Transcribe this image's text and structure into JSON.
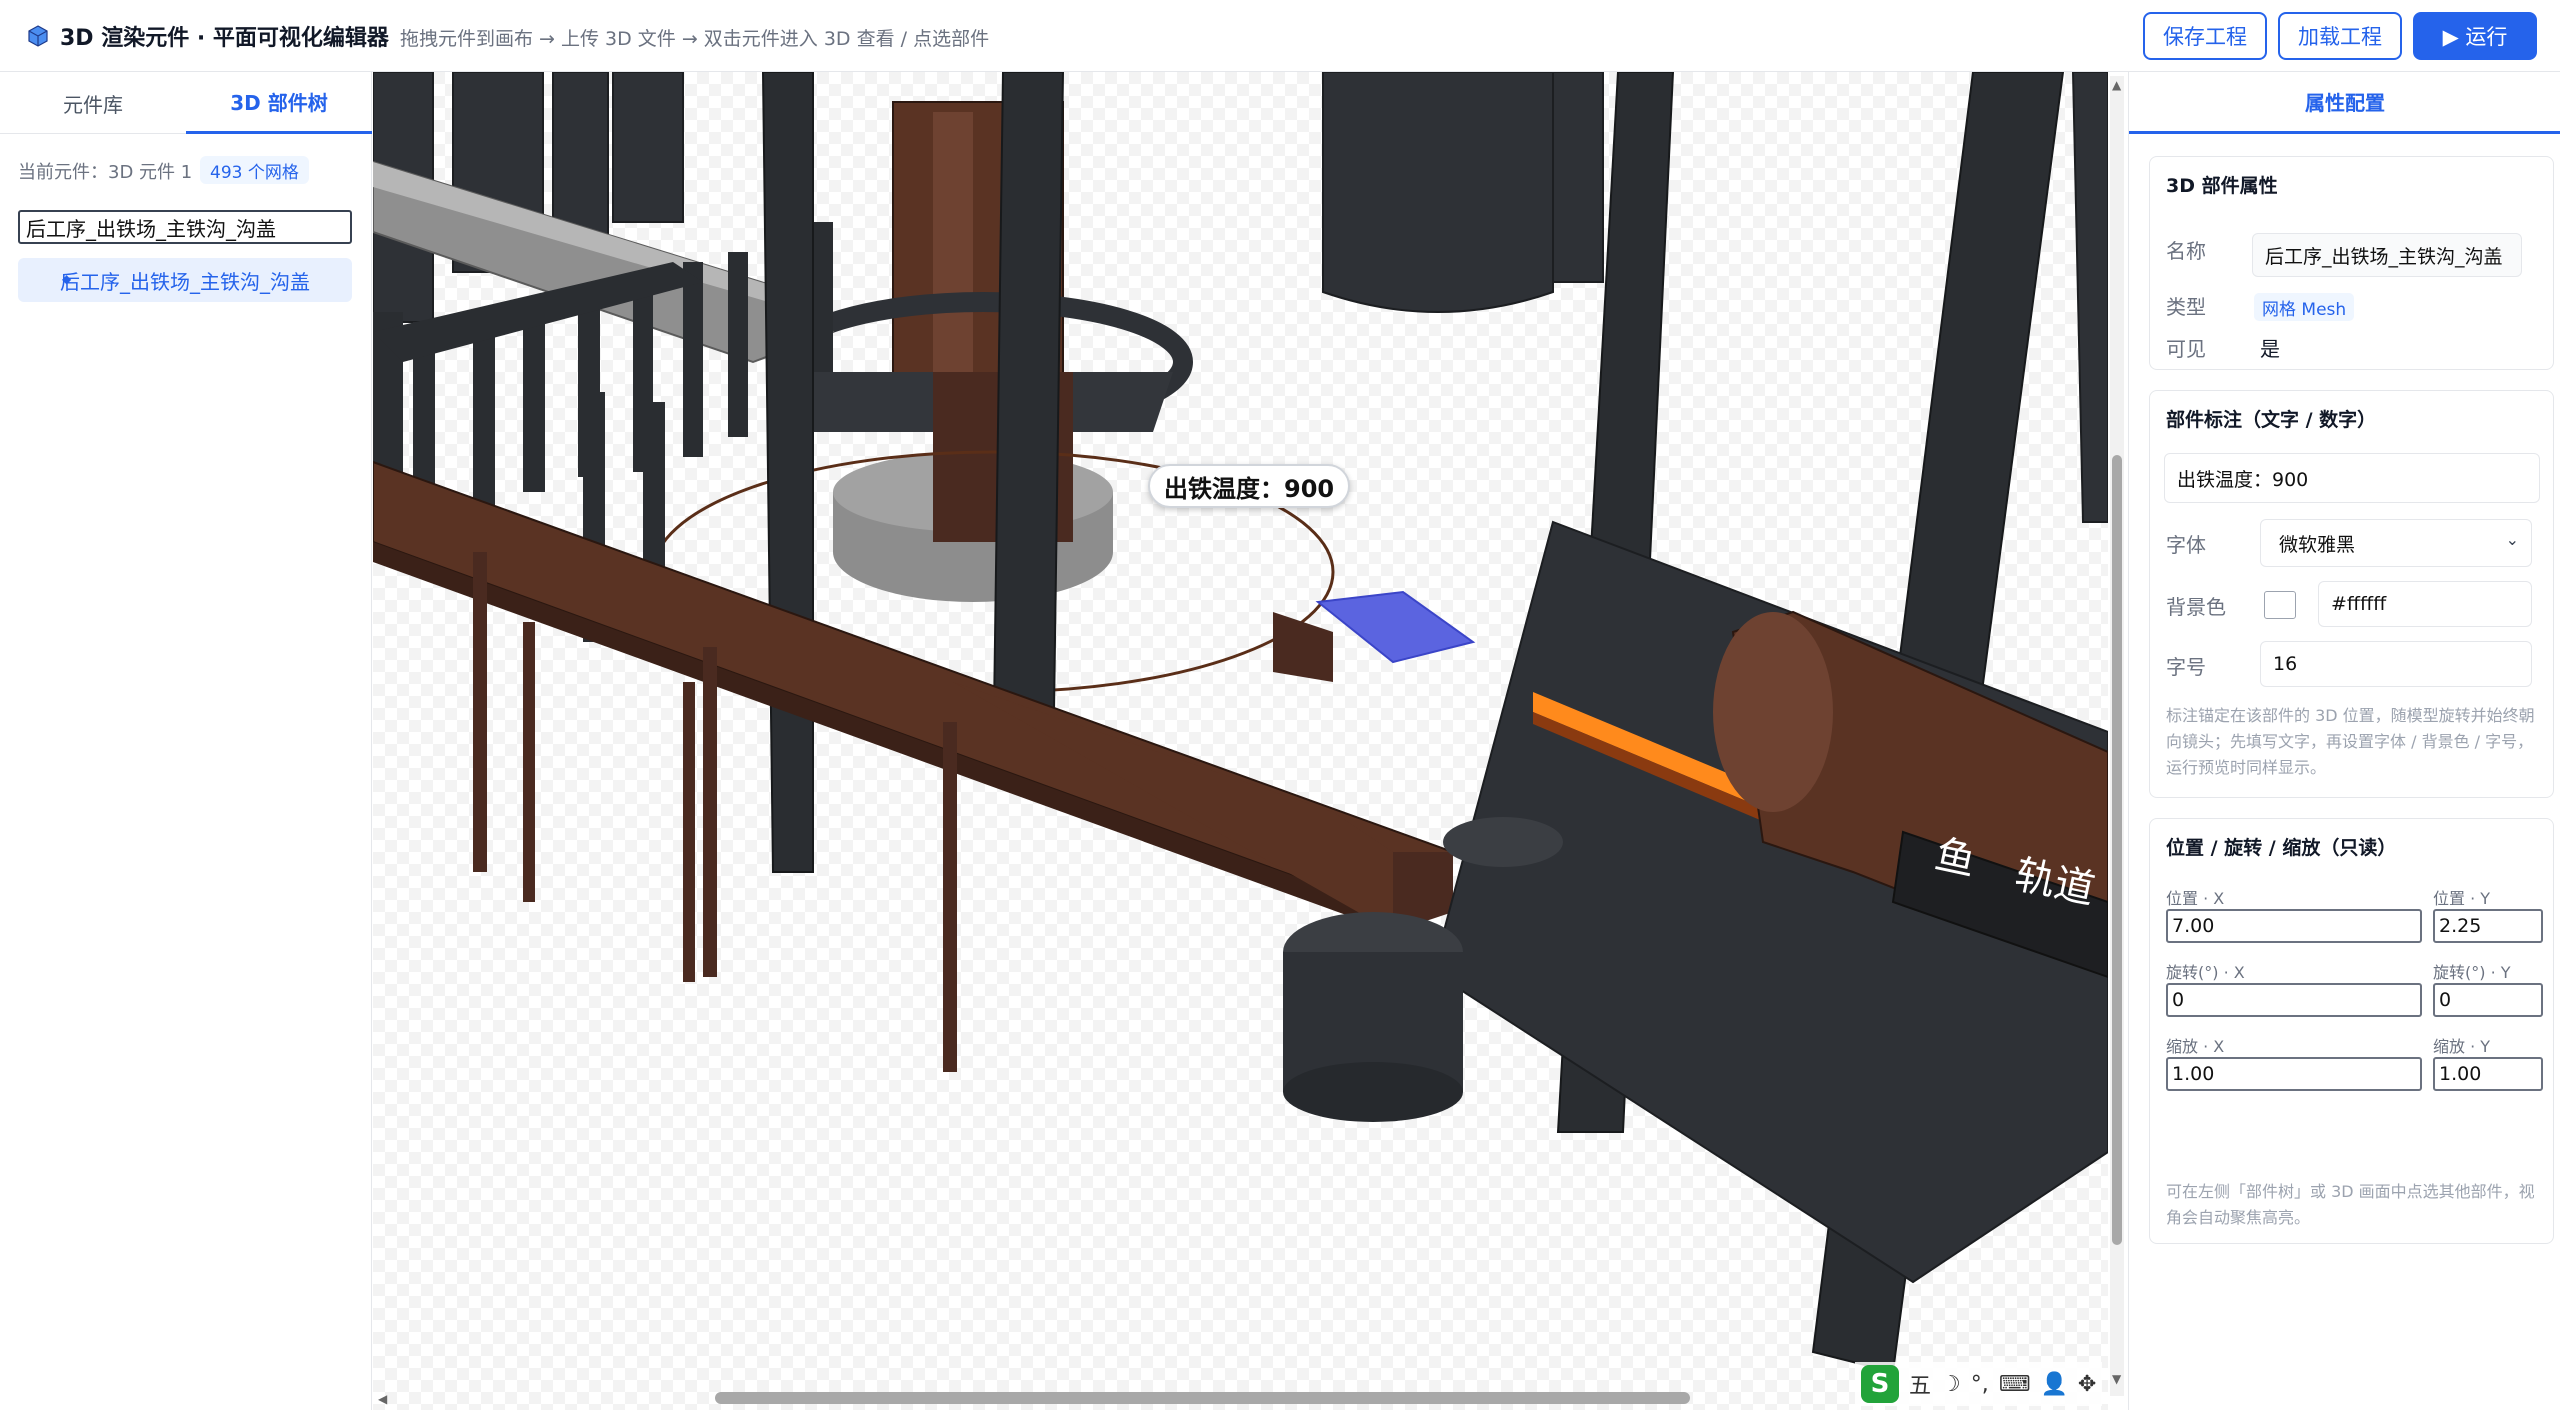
{
  "header": {
    "title": "3D 渲染元件 · 平面可视化编辑器",
    "hint": "拖拽元件到画布 → 上传 3D 文件 → 双击元件进入 3D 查看 / 点选部件",
    "save_label": "保存工程",
    "load_label": "加载工程",
    "run_label": "▶ 运行",
    "logo_icon": "cube-icon"
  },
  "left": {
    "tabs": [
      {
        "label": "元件库",
        "active": false
      },
      {
        "label": "3D 部件树",
        "active": true
      }
    ],
    "current_component": "当前元件：3D 元件 1",
    "mesh_count": "493 个网格",
    "search_value": "后工序_出铁场_主铁沟_沟盖",
    "tree_items": [
      {
        "label": "后工序_出铁场_主铁沟_沟盖",
        "selected": true
      }
    ]
  },
  "viewport": {
    "annotation_text": "出铁温度：900",
    "sign_left": "鱼",
    "sign_right": "轨道"
  },
  "ime": {
    "logo": "S",
    "items": [
      "五",
      "☽",
      "°,",
      "⌨",
      "👤",
      "✥"
    ]
  },
  "right": {
    "tab_label": "属性配置",
    "part_props": {
      "title": "3D 部件属性",
      "name_label": "名称",
      "name_value": "后工序_出铁场_主铁沟_沟盖",
      "type_label": "类型",
      "type_value": "网格 Mesh",
      "visible_label": "可见",
      "visible_value": "是"
    },
    "annotation": {
      "title": "部件标注（文字 / 数字）",
      "text_value": "出铁温度：900",
      "font_label": "字体",
      "font_value": "微软雅黑",
      "bg_label": "背景色",
      "bg_value": "#ffffff",
      "size_label": "字号",
      "size_value": "16",
      "help": "标注锚定在该部件的 3D 位置，随模型旋转并始终朝向镜头；先填写文字，再设置字体 / 背景色 / 字号，运行预览时同样显示。"
    },
    "transform": {
      "title": "位置 / 旋转 / 缩放（只读）",
      "pos_x_label": "位置 · X",
      "pos_x": "7.00",
      "pos_y_label": "位置 · Y",
      "pos_y": "2.25",
      "rot_x_label": "旋转(°) · X",
      "rot_x": "0",
      "rot_y_label": "旋转(°) · Y",
      "rot_y": "0",
      "scale_x_label": "缩放 · X",
      "scale_x": "1.00",
      "scale_y_label": "缩放 · Y",
      "scale_y": "1.00",
      "help": "可在左侧「部件树」或 3D 画面中点选其他部件，视角会自动聚焦高亮。"
    }
  },
  "colors": {
    "accent": "#2563eb",
    "highlight_mesh": "#5b64e0",
    "rust": "#4a2a20",
    "steel": "#2a2d31",
    "orange_rail": "#ff8a1c"
  }
}
